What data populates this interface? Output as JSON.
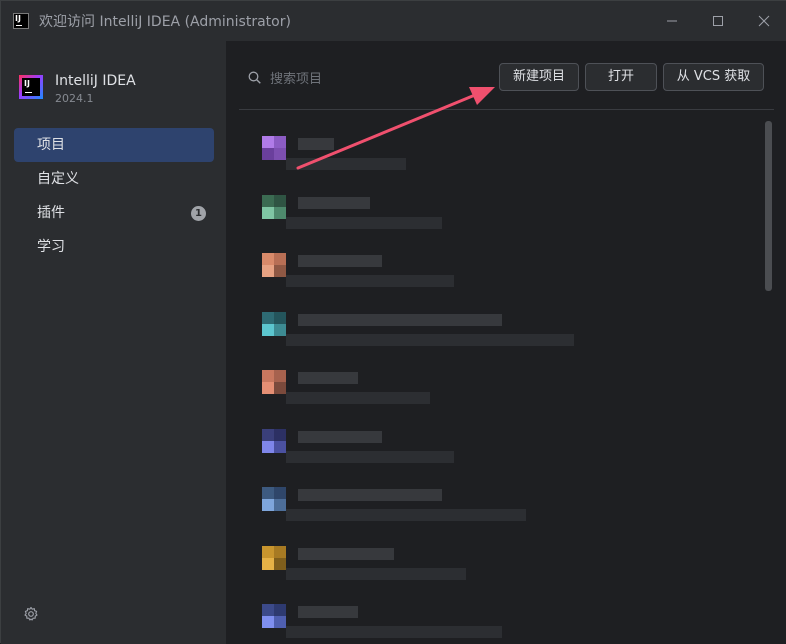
{
  "window": {
    "title": "欢迎访问 IntelliJ IDEA (Administrator)",
    "controls": [
      "minimize-icon",
      "maximize-icon",
      "close-icon"
    ]
  },
  "brand": {
    "name": "IntelliJ IDEA",
    "version": "2024.1"
  },
  "sidebar": {
    "items": [
      {
        "label": "项目",
        "active": true
      },
      {
        "label": "自定义",
        "active": false
      },
      {
        "label": "插件",
        "active": false,
        "badge": "1"
      },
      {
        "label": "学习",
        "active": false
      }
    ],
    "settings_icon": "gear-icon"
  },
  "toolbar": {
    "search_placeholder": "搜索项目",
    "new_project_label": "新建项目",
    "open_label": "打开",
    "vcs_label": "从 VCS 获取"
  },
  "projects": [
    {
      "colors": [
        "#b07be8",
        "#8c5cc4",
        "#6a3f9c",
        "#7d4fb0"
      ]
    },
    {
      "colors": [
        "#3b6b52",
        "#2f5443",
        "#7fc6a4",
        "#4e8a6d"
      ]
    },
    {
      "colors": [
        "#d98a6a",
        "#b86f55",
        "#e7a283",
        "#8f5844"
      ]
    },
    {
      "colors": [
        "#2e6b74",
        "#24555c",
        "#5cc6cf",
        "#3d8b93"
      ]
    },
    {
      "colors": [
        "#c9785f",
        "#a7624e",
        "#e58f74",
        "#7b4a3c"
      ]
    },
    {
      "colors": [
        "#3a3f7a",
        "#2c3063",
        "#7f86ea",
        "#4b51a0"
      ]
    },
    {
      "colors": [
        "#3d5a80",
        "#2f466a",
        "#7fa6dc",
        "#4d6e99"
      ]
    },
    {
      "colors": [
        "#c8952e",
        "#a77a23",
        "#e5b146",
        "#7f5e1c"
      ]
    },
    {
      "colors": [
        "#3c4a8a",
        "#2e3a70",
        "#7f8ff0",
        "#4f5fb0"
      ]
    }
  ],
  "colors": {
    "accent_selected": "#2e436e",
    "annotation_arrow": "#f0506e"
  }
}
